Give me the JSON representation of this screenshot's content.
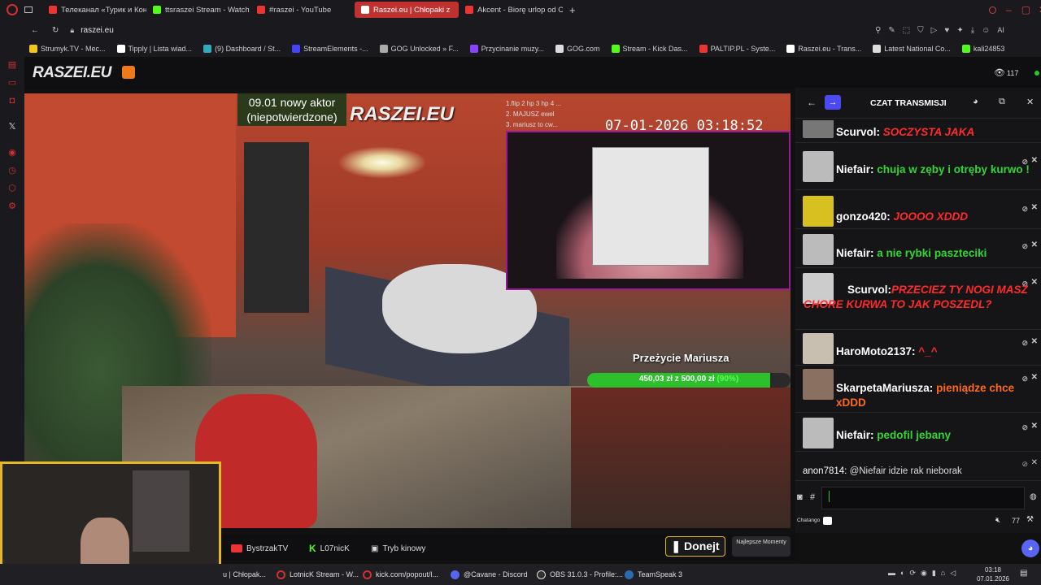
{
  "tabs": [
    {
      "label": "Телеканал «Турик и Коне",
      "color": "#e33"
    },
    {
      "label": "ttsraszei Stream - Watch L",
      "color": "#53fc18"
    },
    {
      "label": "#raszei - YouTube",
      "color": "#e33"
    },
    {
      "label": "Raszei.eu | Chłopaki z",
      "color": "#fff",
      "active": true
    },
    {
      "label": "Akcent - Biorę urlop od Ci",
      "color": "#e33"
    }
  ],
  "new_tab": "+",
  "address": "raszei.eu",
  "bookmarks": [
    {
      "label": "Strumyk.TV - Mec...",
      "color": "#f5c518"
    },
    {
      "label": "Tipply | Lista wiad...",
      "color": "#fff"
    },
    {
      "label": "(9) Dashboard / St...",
      "color": "#3ab"
    },
    {
      "label": "StreamElements -...",
      "color": "#44f"
    },
    {
      "label": "GOG Unlocked » F...",
      "color": "#aaa"
    },
    {
      "label": "Przycinanie muzy...",
      "color": "#84f"
    },
    {
      "label": "GOG.com",
      "color": "#ddd"
    },
    {
      "label": "Stream - Kick Das...",
      "color": "#53fc18"
    },
    {
      "label": "PALTIP.PL - Syste...",
      "color": "#e33"
    },
    {
      "label": "Raszei.eu - Trans...",
      "color": "#fff"
    },
    {
      "label": "Latest National Co...",
      "color": "#ddd"
    },
    {
      "label": "kali24853",
      "color": "#53fc18"
    }
  ],
  "site": {
    "logo": "RASZEI.EU",
    "viewers": "117"
  },
  "overlay": {
    "actor_line1": "09.01 nowy aktor",
    "actor_line2": "(niepotwierdzone)",
    "watermark": "RASZEI.EU",
    "timestamp": "07-01-2026 03:18:52",
    "top_donors": [
      "1.flip 2 hp 3 hp 4 ...",
      "2. MAJUSZ ewel",
      "3. mariusz to cw..."
    ],
    "goal_title": "Przeżycie Mariusza",
    "goal_text": "450,03 zł z 500,00 zł",
    "goal_pct": "(90%)",
    "goal_fraction": 0.9
  },
  "chat": {
    "title": "CZAT TRANSMISJI",
    "messages": [
      {
        "user": "Scurvol:",
        "text": "SOCZYSTA JAKA",
        "color": "#ff2a2a",
        "italic": true
      },
      {
        "user": "Niefair:",
        "text": "chuja w zęby i otręby kurwo !",
        "color": "#35d435"
      },
      {
        "user": "gonzo420:",
        "text": "JOOOO XDDD",
        "color": "#ff2a2a",
        "italic": true
      },
      {
        "user": "Niefair:",
        "text": "a nie rybki paszteciki",
        "color": "#35d435"
      },
      {
        "user": "Scurvol:",
        "text": "PRZECIEZ TY NOGI MASZ CHORE KURWA TO JAK POSZEDL?",
        "color": "#ff2a2a",
        "italic": true
      },
      {
        "user": "HaroMoto2137:",
        "text": "^_^",
        "color": "#ff2a2a"
      },
      {
        "user": "SkarpetaMariusza:",
        "text": "pieniądze chce xDDD",
        "color": "#ff6a1a"
      },
      {
        "user": "Niefair:",
        "text": "pedofil jebany",
        "color": "#35d435"
      },
      {
        "user": "anon7814:",
        "text": "@Niefair idzie rak nieborak",
        "color": "#ddd"
      }
    ],
    "input_prefix": "#",
    "chatango": "Chatango",
    "online_count": "77"
  },
  "bottom": {
    "channels": [
      "BystrzakTV",
      "L07nicK",
      "Tryb kinowy"
    ],
    "donate": "Donejt",
    "najlepsze": "Najlepsze Momenty"
  },
  "taskbar": {
    "items": [
      "u | Chłopak...",
      "LotnicK Stream - W...",
      "kick.com/popout/l...",
      "@Cavane - Discord",
      "OBS 31.0.3 - Profile:...",
      "TeamSpeak 3"
    ],
    "time": "03:18",
    "date": "07.01.2026"
  }
}
